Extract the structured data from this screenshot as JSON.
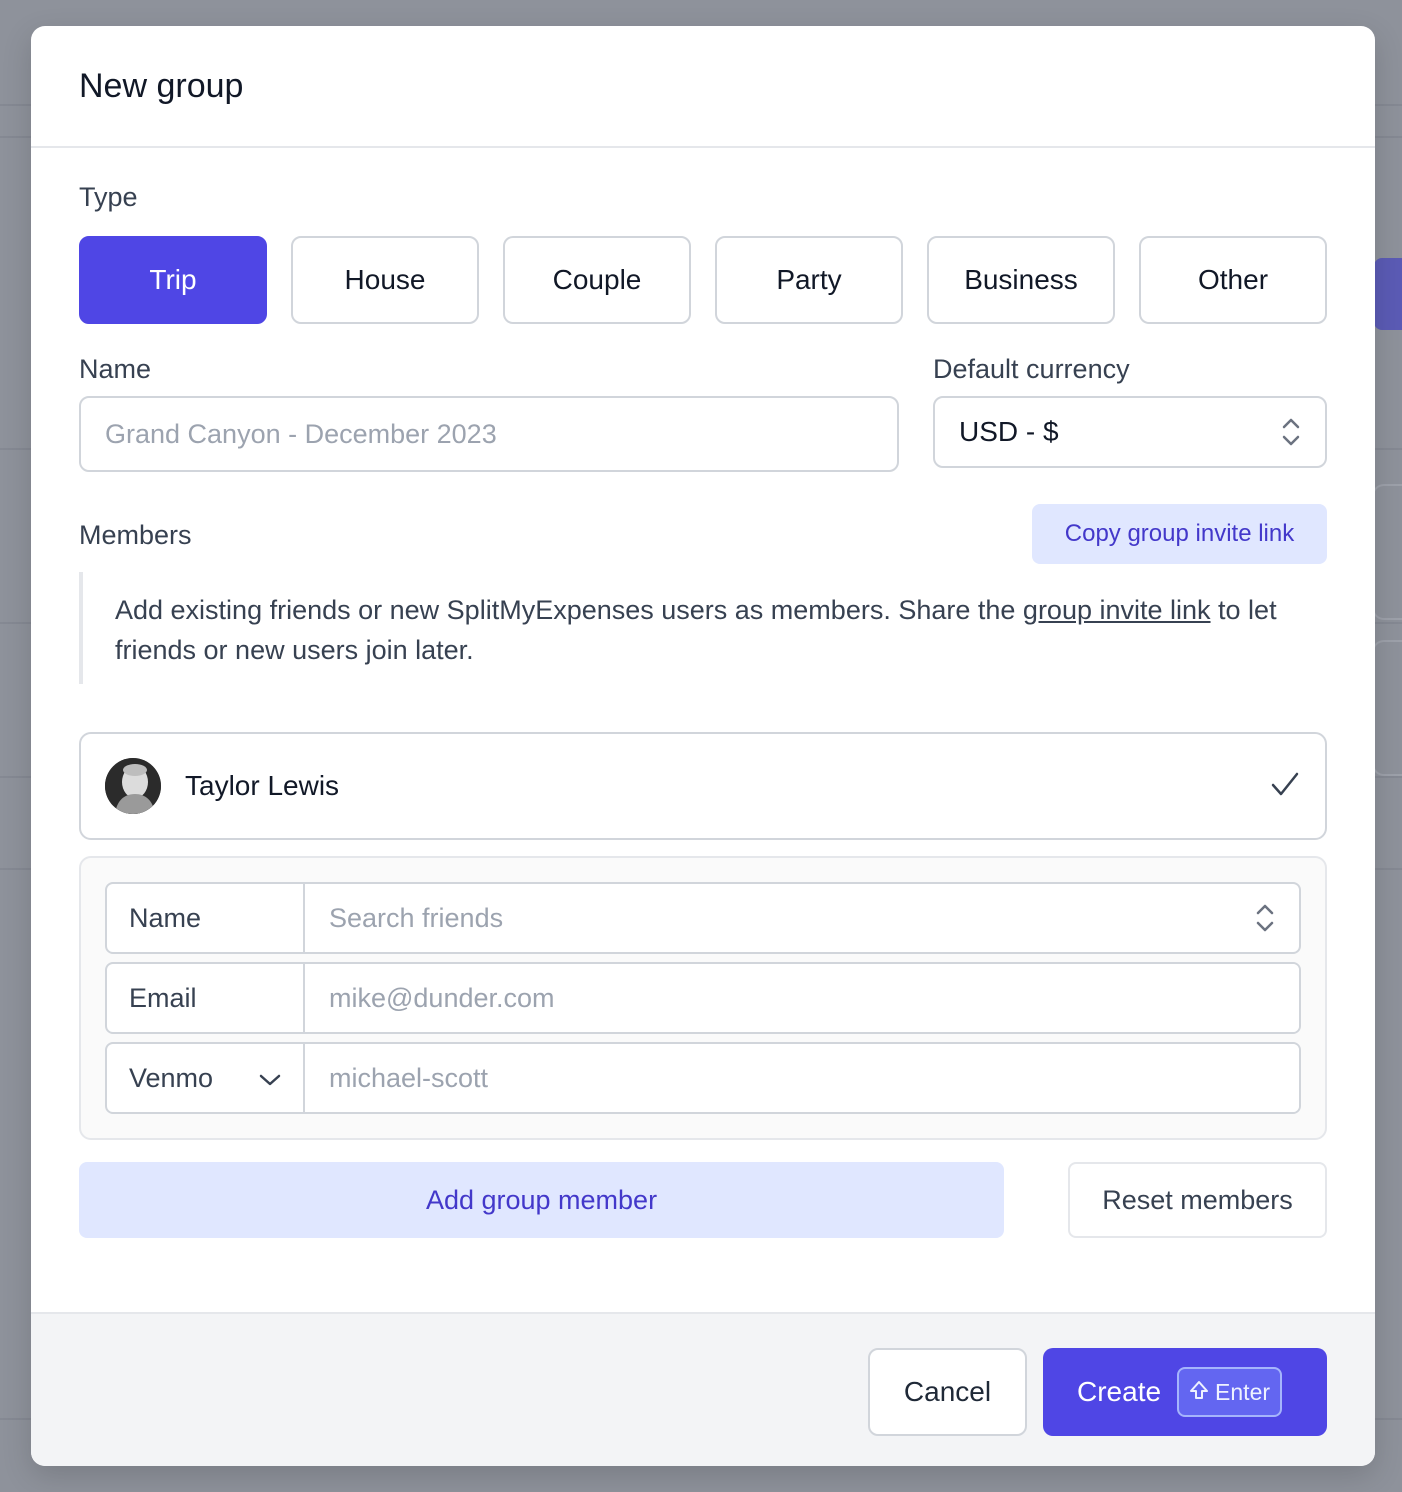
{
  "modal": {
    "title": "New group"
  },
  "type_section": {
    "label": "Type",
    "options": [
      "Trip",
      "House",
      "Couple",
      "Party",
      "Business",
      "Other"
    ],
    "selected": "Trip"
  },
  "name_field": {
    "label": "Name",
    "placeholder": "Grand Canyon - December 2023",
    "value": ""
  },
  "currency_field": {
    "label": "Default currency",
    "value": "USD - $"
  },
  "members_section": {
    "label": "Members",
    "copy_invite_label": "Copy group invite link",
    "info_text_before": "Add existing friends or new SplitMyExpenses users as members. Share the ",
    "info_link": "group invite link",
    "info_text_after": " to let friends or new users join later.",
    "members": [
      {
        "name": "Taylor Lewis",
        "selected": true
      }
    ]
  },
  "new_member": {
    "name_label": "Name",
    "name_placeholder": "Search friends",
    "email_label": "Email",
    "email_placeholder": "mike@dunder.com",
    "payment_label": "Venmo",
    "payment_placeholder": "michael-scott"
  },
  "actions": {
    "add_member_label": "Add group member",
    "reset_members_label": "Reset members",
    "cancel_label": "Cancel",
    "create_label": "Create",
    "create_shortcut": "Enter"
  },
  "colors": {
    "primary": "#4f46e5",
    "primary_light": "#e0e7ff",
    "primary_text": "#4338ca",
    "overlay": "#8e929b"
  },
  "icons": {
    "currency_select": "chevron-up-down-icon",
    "member_check": "check-icon",
    "friends_select": "chevron-up-down-icon",
    "payment_dropdown": "chevron-down-icon",
    "shortcut": "shift-arrow-icon"
  }
}
